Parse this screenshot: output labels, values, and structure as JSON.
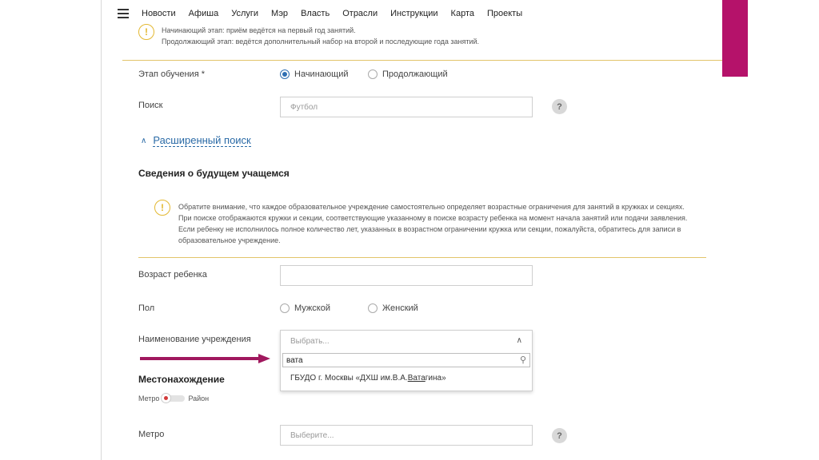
{
  "nav": {
    "items": [
      "Новости",
      "Афиша",
      "Услуги",
      "Мэр",
      "Власть",
      "Отрасли",
      "Инструкции",
      "Карта",
      "Проекты"
    ]
  },
  "top_note": {
    "line1": "Начинающий этап: приём ведётся на первый год занятий.",
    "line2": "Продолжающий этап: ведётся дополнительный набор на второй и последующие года занятий."
  },
  "stage": {
    "label": "Этап обучения *",
    "options": [
      "Начинающий",
      "Продолжающий"
    ],
    "selected": "Начинающий"
  },
  "search": {
    "label": "Поиск",
    "placeholder": "Футбол",
    "help": "?"
  },
  "advanced_search": {
    "chevron": "∧",
    "label": "Расширенный поиск"
  },
  "student_section": {
    "title": "Сведения о будущем учащемся",
    "notice": "Обратите внимание, что каждое образовательное учреждение самостоятельно определяет возрастные ограничения для занятий в кружках и секциях. При поиске отображаются кружки и секции, соответствующие указанному в поиске возрасту ребенка на момент начала занятий или подачи заявления. Если ребенку не исполнилось полное количество лет, указанных в возрастном ограничении кружка или секции, пожалуйста, обратитесь для записи в образовательное учреждение."
  },
  "age": {
    "label": "Возраст ребенка",
    "value": ""
  },
  "gender": {
    "label": "Пол",
    "options": [
      "Мужской",
      "Женский"
    ]
  },
  "institution": {
    "label": "Наименование учреждения",
    "placeholder": "Выбрать...",
    "search_value": "вата",
    "option_prefix": "ГБУДО г. Москвы «ДХШ им.В.А.",
    "option_match": "Вата",
    "option_suffix": "гина»"
  },
  "location": {
    "title": "Местонахождение",
    "toggle_left": "Метро",
    "toggle_right": "Район"
  },
  "metro": {
    "label": "Метро",
    "placeholder": "Выберите...",
    "help": "?"
  },
  "icons": {
    "warning_glyph": "!",
    "search_glyph": "⚲",
    "caret": "∧"
  },
  "colors": {
    "accent": "#b5126a",
    "link": "#2a6aa6",
    "warning": "#e3b831",
    "arrow": "#a0185e"
  }
}
